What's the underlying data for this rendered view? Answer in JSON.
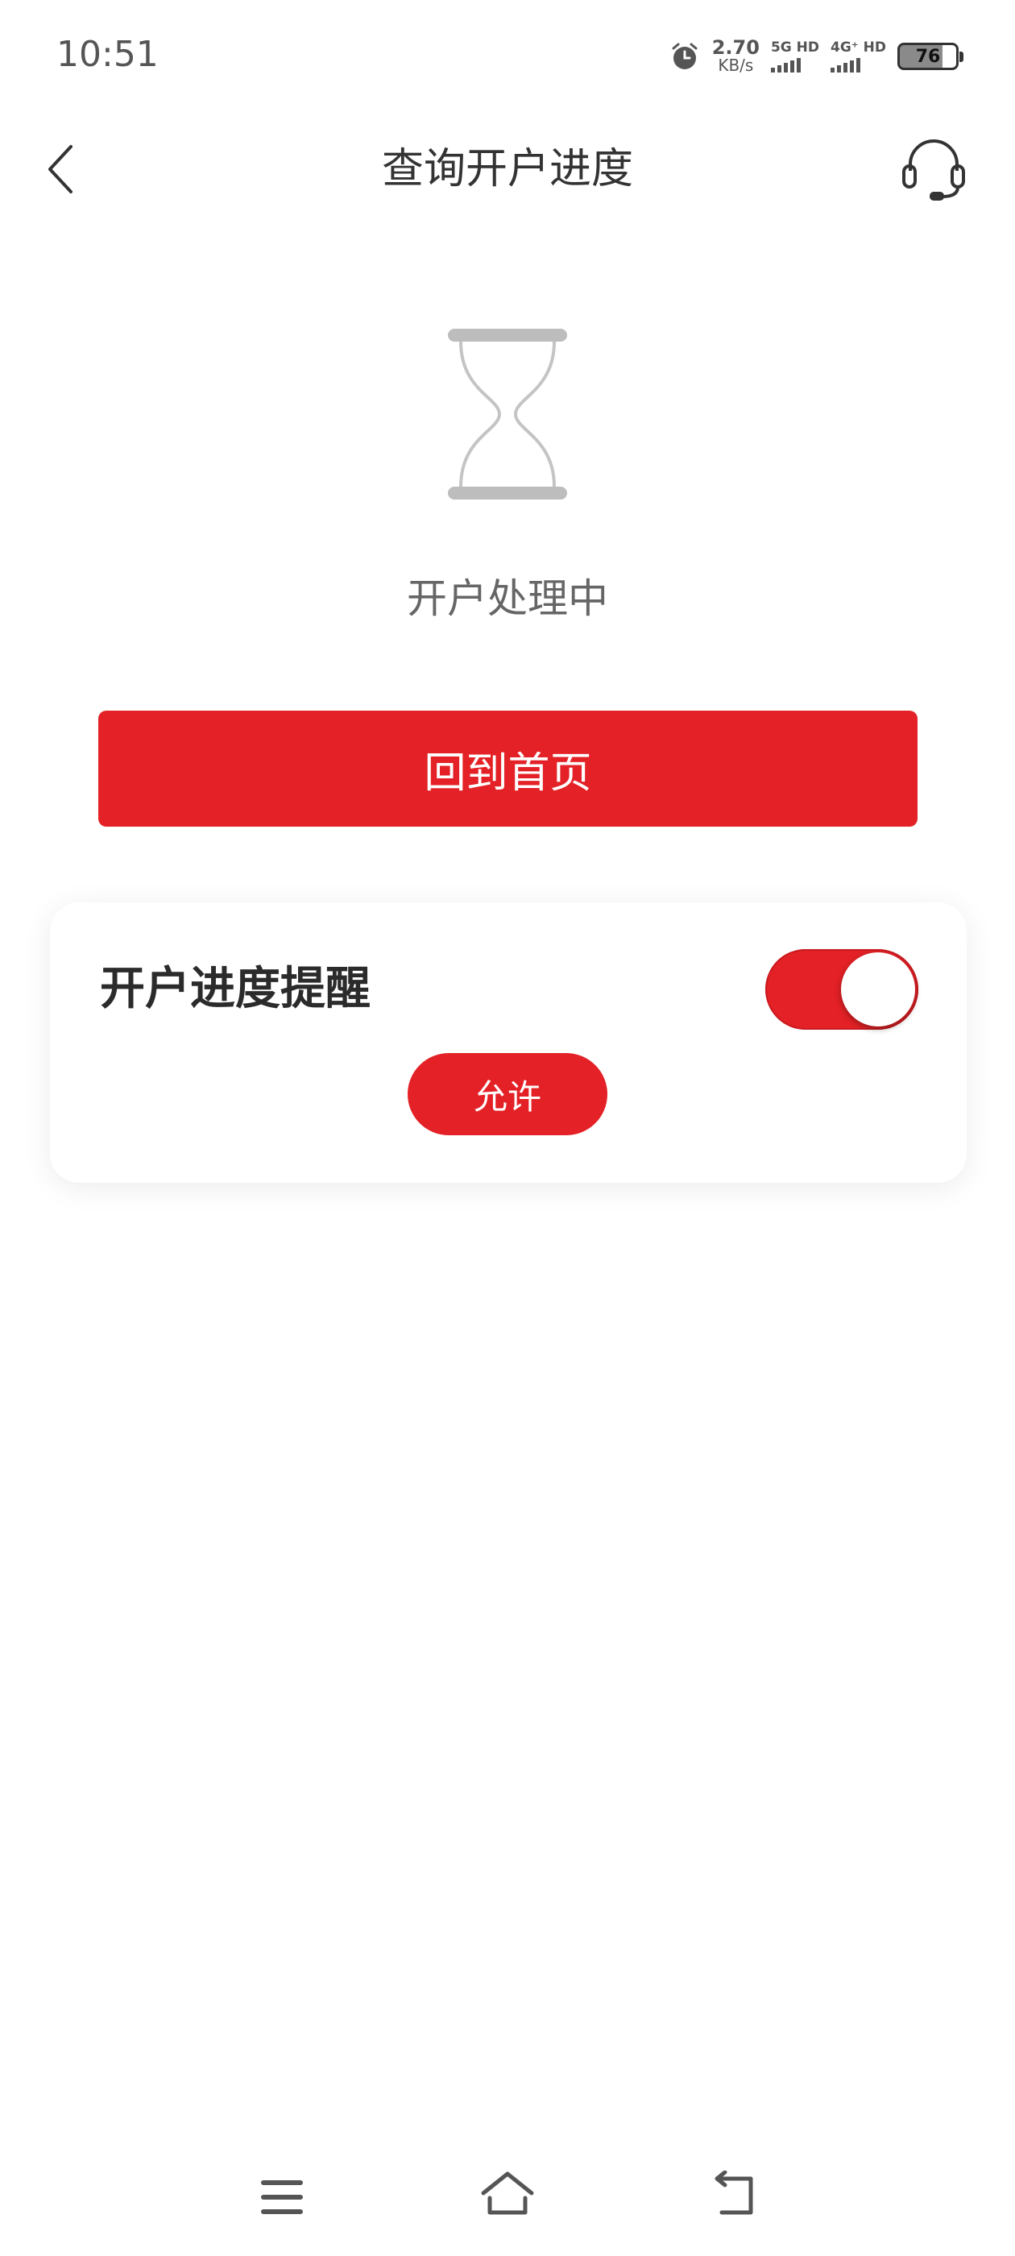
{
  "status_bar": {
    "time": "10:51",
    "speed_value": "2.70",
    "speed_unit": "KB/s",
    "net1": "5G HD",
    "net2": "4G⁺ HD",
    "battery": "76"
  },
  "header": {
    "title": "查询开户进度"
  },
  "progress": {
    "status_text": "开户处理中"
  },
  "home_button": {
    "label": "回到首页"
  },
  "reminder_card": {
    "title": "开户进度提醒",
    "toggle_on": true,
    "allow_label": "允许"
  },
  "colors": {
    "accent": "#e32126",
    "text_primary": "#333333",
    "text_secondary": "#666666",
    "icon_gray": "#bdbdbd"
  },
  "icons": {
    "back": "chevron-left-icon",
    "support": "headset-icon",
    "progress": "hourglass-icon",
    "nav_menu": "menu-icon",
    "nav_home": "home-icon",
    "nav_back": "back-arrow-icon"
  }
}
